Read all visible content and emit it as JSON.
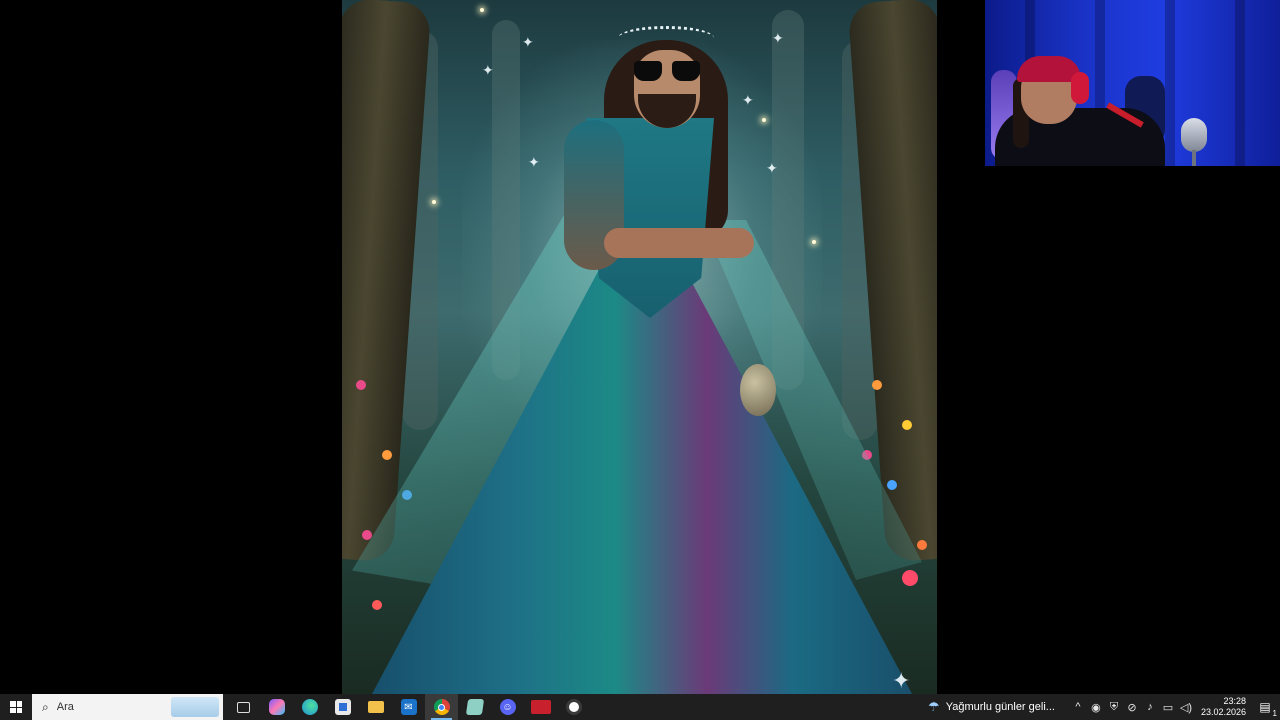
{
  "taskbar": {
    "search": {
      "placeholder": "Ara"
    },
    "apps": [
      {
        "id": "task-view",
        "glyph": "task-view-icon",
        "color": "#2b2b2b"
      },
      {
        "id": "copilot",
        "glyph": "copilot-icon",
        "color": "#7b5cff"
      },
      {
        "id": "edge",
        "glyph": "edge-icon",
        "color": "#1f8fd6"
      },
      {
        "id": "store",
        "glyph": "store-icon",
        "color": "#2f6fd6"
      },
      {
        "id": "file-explorer",
        "glyph": "folder-icon",
        "color": "#f2c14b"
      },
      {
        "id": "outlook",
        "glyph": "mail-icon",
        "color": "#1a73c9"
      },
      {
        "id": "chrome",
        "glyph": "chrome-icon",
        "color": "#2f9e44",
        "active": true
      },
      {
        "id": "notes",
        "glyph": "notes-icon",
        "color": "#6fb7a8"
      },
      {
        "id": "discord",
        "glyph": "discord-icon",
        "color": "#5865f2"
      },
      {
        "id": "video-editor",
        "glyph": "video-editor-icon",
        "color": "#c8202d"
      },
      {
        "id": "obs",
        "glyph": "obs-icon",
        "color": "#3a3a3a"
      }
    ],
    "weather": {
      "text": "Yağmurlu günler geli..."
    },
    "clock": {
      "time": "23:28",
      "date": "23.02.2026"
    },
    "notifications": {
      "count": "1"
    }
  }
}
